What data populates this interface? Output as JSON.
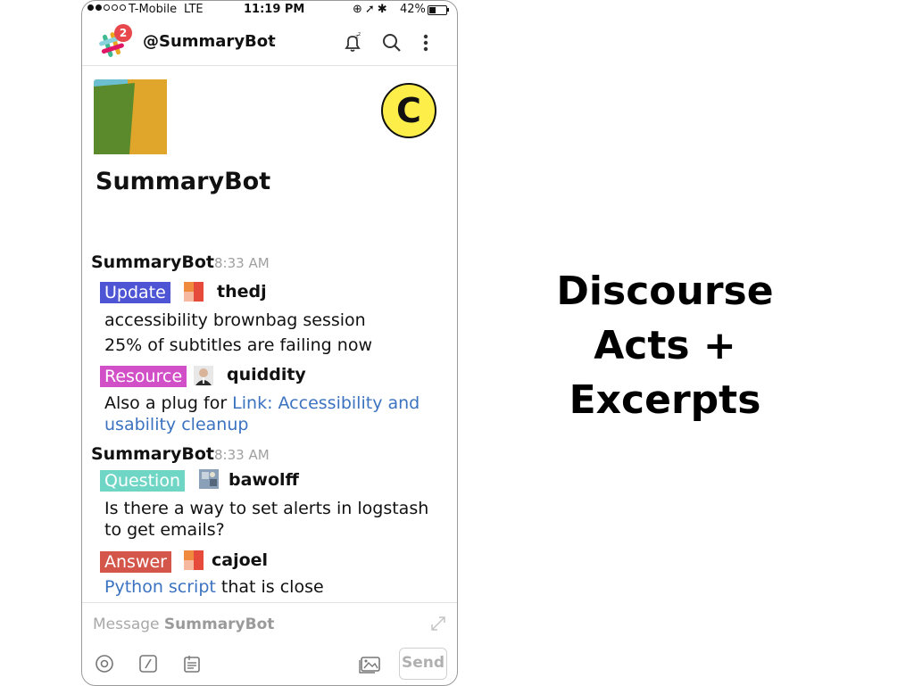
{
  "statusbar": {
    "carrier": "T-Mobile",
    "network": "LTE",
    "time": "11:19 PM",
    "battery": "42%",
    "battery_level": 0.42
  },
  "header": {
    "channel": "@SummaryBot",
    "notification_count": "2"
  },
  "bot": {
    "name": "SummaryBot",
    "badge_letter": "C"
  },
  "messages": [
    {
      "author": "SummaryBot",
      "time": "8:33 AM",
      "acts": [
        {
          "tag": "Update",
          "tag_color": "#4e55d4",
          "user": "thedj",
          "lines": [
            "accessibility brownbag session",
            "25% of subtitles are failing now"
          ]
        },
        {
          "tag": "Resource",
          "tag_color": "#d14fc7",
          "user": "quiddity",
          "text_prefix": "Also a plug for ",
          "link_line1": "Link: Accessibility and",
          "link_line2": "usability cleanup"
        }
      ]
    },
    {
      "author": "SummaryBot",
      "time": "8:33 AM",
      "acts": [
        {
          "tag": "Question",
          "tag_color": "#6fd6c6",
          "user": "bawolff",
          "lines": [
            "Is there a way to set alerts in logstash",
            "to get emails?"
          ]
        },
        {
          "tag": "Answer",
          "tag_color": "#d4564b",
          "user": "cajoel",
          "link": "Python script",
          "text_suffix": " that is close"
        }
      ]
    }
  ],
  "composer": {
    "placeholder_prefix": "Message ",
    "placeholder_name": "SummaryBot",
    "send_label": "Send"
  },
  "slide": {
    "title_lines": [
      "Discourse",
      "Acts +",
      "Excerpts"
    ]
  }
}
